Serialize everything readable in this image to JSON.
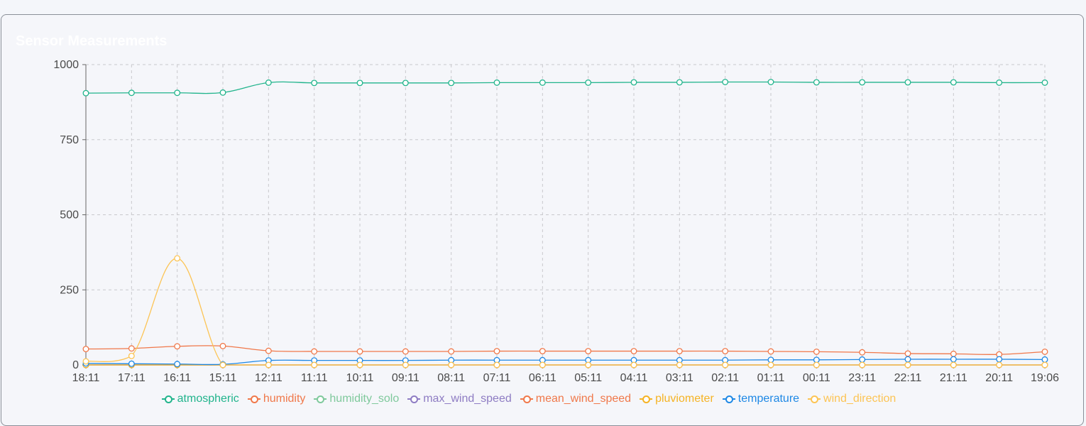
{
  "card": {
    "title": "Sensor Measurements"
  },
  "chart_data": {
    "type": "line",
    "categories": [
      "18:11",
      "17:11",
      "16:11",
      "15:11",
      "12:11",
      "11:11",
      "10:11",
      "09:11",
      "08:11",
      "07:11",
      "06:11",
      "05:11",
      "04:11",
      "03:11",
      "02:11",
      "01:11",
      "00:11",
      "23:11",
      "22:11",
      "21:11",
      "20:11",
      "19:06"
    ],
    "ylim": [
      0,
      1000
    ],
    "yticks": [
      0,
      250,
      500,
      750,
      1000
    ],
    "grid": true,
    "legend_position": "bottom",
    "series": [
      {
        "name": "atmospheric",
        "color": "#21b48c",
        "values": [
          905,
          906,
          906,
          907,
          940,
          939,
          939,
          939,
          939,
          940,
          940,
          940,
          941,
          941,
          942,
          942,
          941,
          941,
          941,
          941,
          940,
          940
        ]
      },
      {
        "name": "humidity",
        "color": "#f0784a",
        "values": [
          53,
          55,
          62,
          63,
          47,
          45,
          45,
          45,
          45,
          46,
          46,
          46,
          46,
          46,
          46,
          45,
          44,
          42,
          38,
          37,
          35,
          44
        ]
      },
      {
        "name": "humidity_solo",
        "color": "#7fc99c",
        "values": [
          0,
          0,
          0,
          0,
          0,
          0,
          0,
          0,
          0,
          0,
          0,
          0,
          0,
          0,
          0,
          0,
          0,
          0,
          0,
          0,
          0,
          0
        ]
      },
      {
        "name": "max_wind_speed",
        "color": "#8e7cc3",
        "values": [
          0,
          0,
          0,
          0,
          0,
          0,
          0,
          0,
          0,
          0,
          0,
          0,
          0,
          0,
          0,
          0,
          0,
          0,
          0,
          0,
          0,
          0
        ]
      },
      {
        "name": "mean_wind_speed",
        "color": "#f0784a",
        "values": [
          0,
          0,
          0,
          0,
          0,
          0,
          0,
          0,
          0,
          0,
          0,
          0,
          0,
          0,
          0,
          0,
          0,
          0,
          0,
          0,
          0,
          0
        ]
      },
      {
        "name": "pluviometer",
        "color": "#f5b324",
        "values": [
          0,
          0,
          0,
          0,
          0,
          0,
          0,
          0,
          0,
          0,
          0,
          0,
          0,
          0,
          0,
          0,
          0,
          0,
          0,
          0,
          0,
          0
        ]
      },
      {
        "name": "temperature",
        "color": "#1e88e5",
        "values": [
          5,
          4,
          3,
          2,
          15,
          15,
          15,
          15,
          16,
          16,
          16,
          16,
          16,
          16,
          16,
          17,
          17,
          18,
          19,
          19,
          19,
          18
        ]
      },
      {
        "name": "wind_direction",
        "color": "#fcc454",
        "values": [
          12,
          30,
          355,
          0,
          0,
          0,
          0,
          0,
          0,
          0,
          0,
          0,
          0,
          0,
          0,
          0,
          0,
          0,
          0,
          0,
          0,
          0
        ]
      }
    ]
  }
}
